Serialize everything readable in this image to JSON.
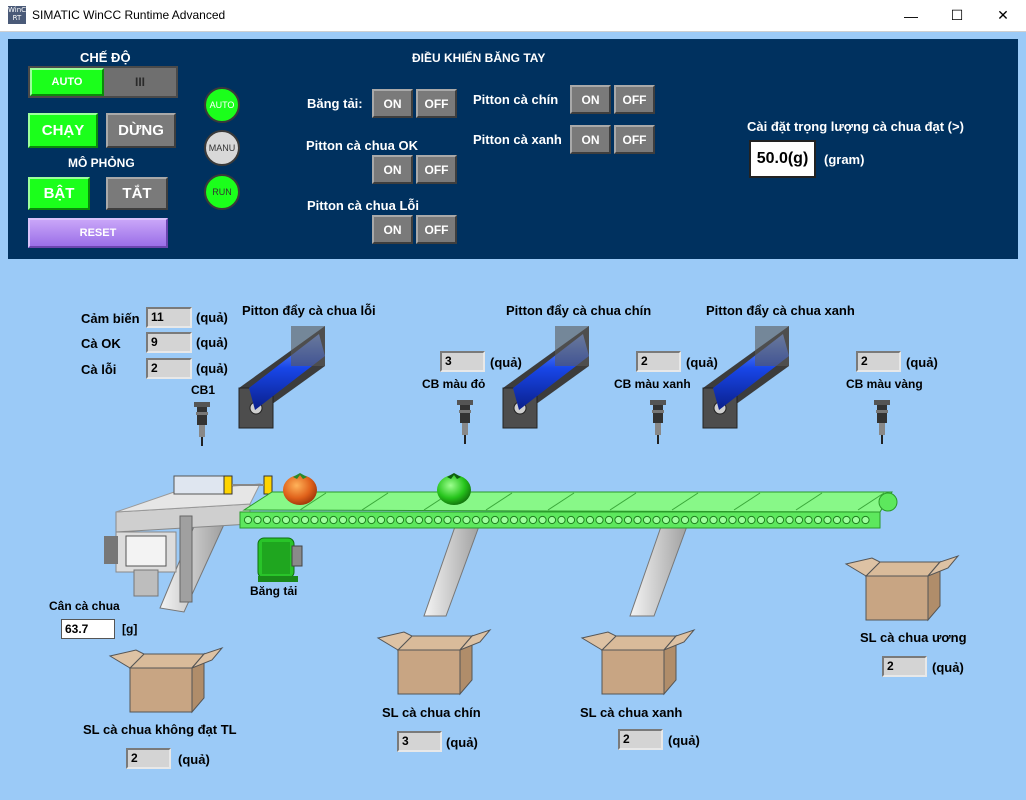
{
  "window": {
    "icon_text": "WinCC RT",
    "title": "SIMATIC WinCC Runtime Advanced",
    "minimize": "—",
    "maximize": "☐",
    "close": "✕"
  },
  "mode": {
    "title": "CHẾ ĐỘ",
    "auto_label": "AUTO",
    "switch_label": "III",
    "run_label": "CHẠY",
    "stop_label": "DỪNG",
    "sim_title": "MÔ PHỎNG",
    "on_label": "BẬT",
    "off_label": "TẮT",
    "reset_label": "RESET"
  },
  "lamps": {
    "auto": "AUTO",
    "manu": "MANU",
    "run": "RUN"
  },
  "manual": {
    "title": "ĐIỀU KHIỂN BĂNG TAY",
    "conveyor": "Băng tải:",
    "piston_ok": "Pitton cà chua OK",
    "piston_fault": "Pitton cà chua Lỗi",
    "piston_ripe": "Pitton cà chín",
    "piston_green": "Pitton cà xanh",
    "on": "ON",
    "off": "OFF"
  },
  "weight_setting": {
    "label": "Cài đặt trọng lượng cà chua đạt (>)",
    "value": "50.0(g)",
    "unit": "(gram)"
  },
  "counters": {
    "sensor_label": "Cảm biến",
    "sensor_value": "11",
    "ok_label": "Cà OK",
    "ok_value": "9",
    "fault_label": "Cà lỗi",
    "fault_value": "2",
    "unit": "(quả)"
  },
  "pistons": {
    "fault": "Pitton đẩy cà chua lỗi",
    "ripe": "Pitton đẩy cà chua chín",
    "green": "Pitton đẩy cà chua xanh"
  },
  "sensors": {
    "cb1": "CB1",
    "red": "CB màu đỏ",
    "red_value": "3",
    "green": "CB màu xanh",
    "green_value": "2",
    "yellow": "CB màu vàng",
    "yellow_value": "2"
  },
  "conveyor_label": "Băng tải",
  "scale": {
    "label": "Cân cà chua",
    "value": "63.7",
    "unit": "[g]"
  },
  "bins": {
    "reject_label": "SL cà chua không đạt TL",
    "reject_value": "2",
    "ripe_label": "SL cà chua chín",
    "ripe_value": "3",
    "green_label": "SL cà chua xanh",
    "green_value": "2",
    "unripe_label": "SL cà chua ương",
    "unripe_value": "2",
    "unit": "(quả)"
  },
  "colors": {
    "panel": "#00315f",
    "background": "#9bcaf7",
    "active_green": "#1bff1b",
    "conveyor": "#66f266",
    "reset": "#b58cf0"
  }
}
